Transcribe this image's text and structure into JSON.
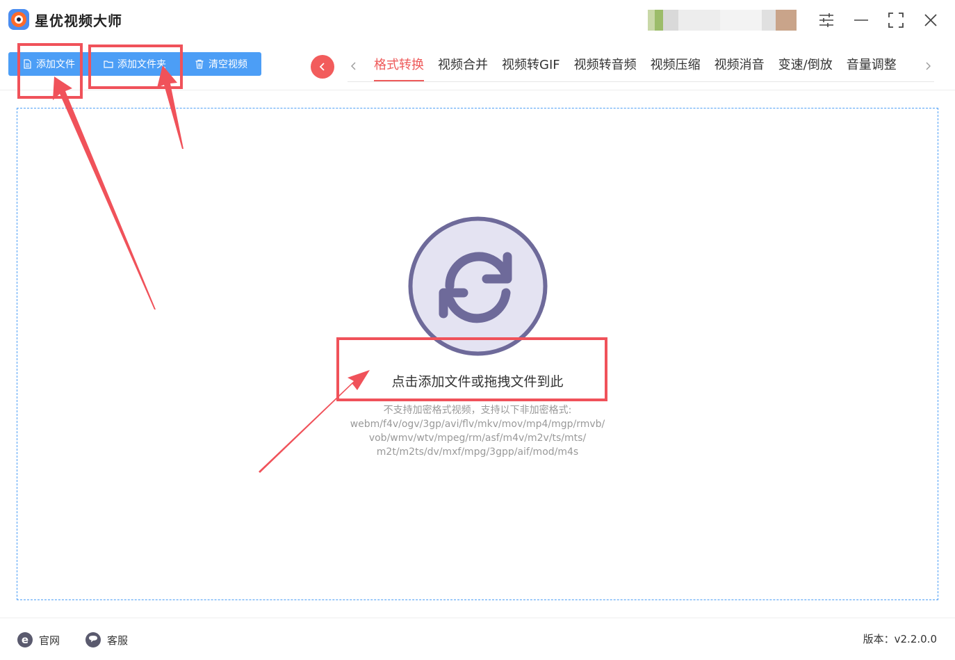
{
  "app": {
    "title": "星优视频大师"
  },
  "toolbar": {
    "add_file": "添加文件",
    "add_folder": "添加文件夹",
    "clear_videos": "清空视频"
  },
  "tabs": [
    {
      "label": "格式转换",
      "active": true
    },
    {
      "label": "视频合并",
      "active": false
    },
    {
      "label": "视频转GIF",
      "active": false
    },
    {
      "label": "视频转音频",
      "active": false
    },
    {
      "label": "视频压缩",
      "active": false
    },
    {
      "label": "视频消音",
      "active": false
    },
    {
      "label": "变速/倒放",
      "active": false
    },
    {
      "label": "音量调整",
      "active": false
    }
  ],
  "dropzone": {
    "main_text": "点击添加文件或拖拽文件到此",
    "sub_lines": [
      "不支持加密格式视频，支持以下非加密格式:",
      "webm/f4v/ogv/3gp/avi/flv/mkv/mov/mp4/mgp/rmvb/",
      "vob/wmv/wtv/mpeg/rm/asf/m4v/m2v/ts/mts/",
      "m2t/m2ts/dv/mxf/mpg/3gpp/aif/mod/m4s"
    ]
  },
  "footer": {
    "website": "官网",
    "support": "客服",
    "version": "版本：v2.2.0.0"
  },
  "colors": {
    "primary_blue": "#4c9ef6",
    "accent_red": "#ee5a5a",
    "annotation_red": "#f0525a",
    "icon_purple": "#6e6a9a",
    "icon_fill": "#e4e3f2"
  },
  "icons": {
    "settings": "sliders-icon",
    "minimize": "minimize-icon",
    "maximize": "fullscreen-icon",
    "close": "close-icon",
    "convert": "refresh-icon",
    "website": "ie-browser-icon",
    "support": "chat-bubble-icon"
  }
}
